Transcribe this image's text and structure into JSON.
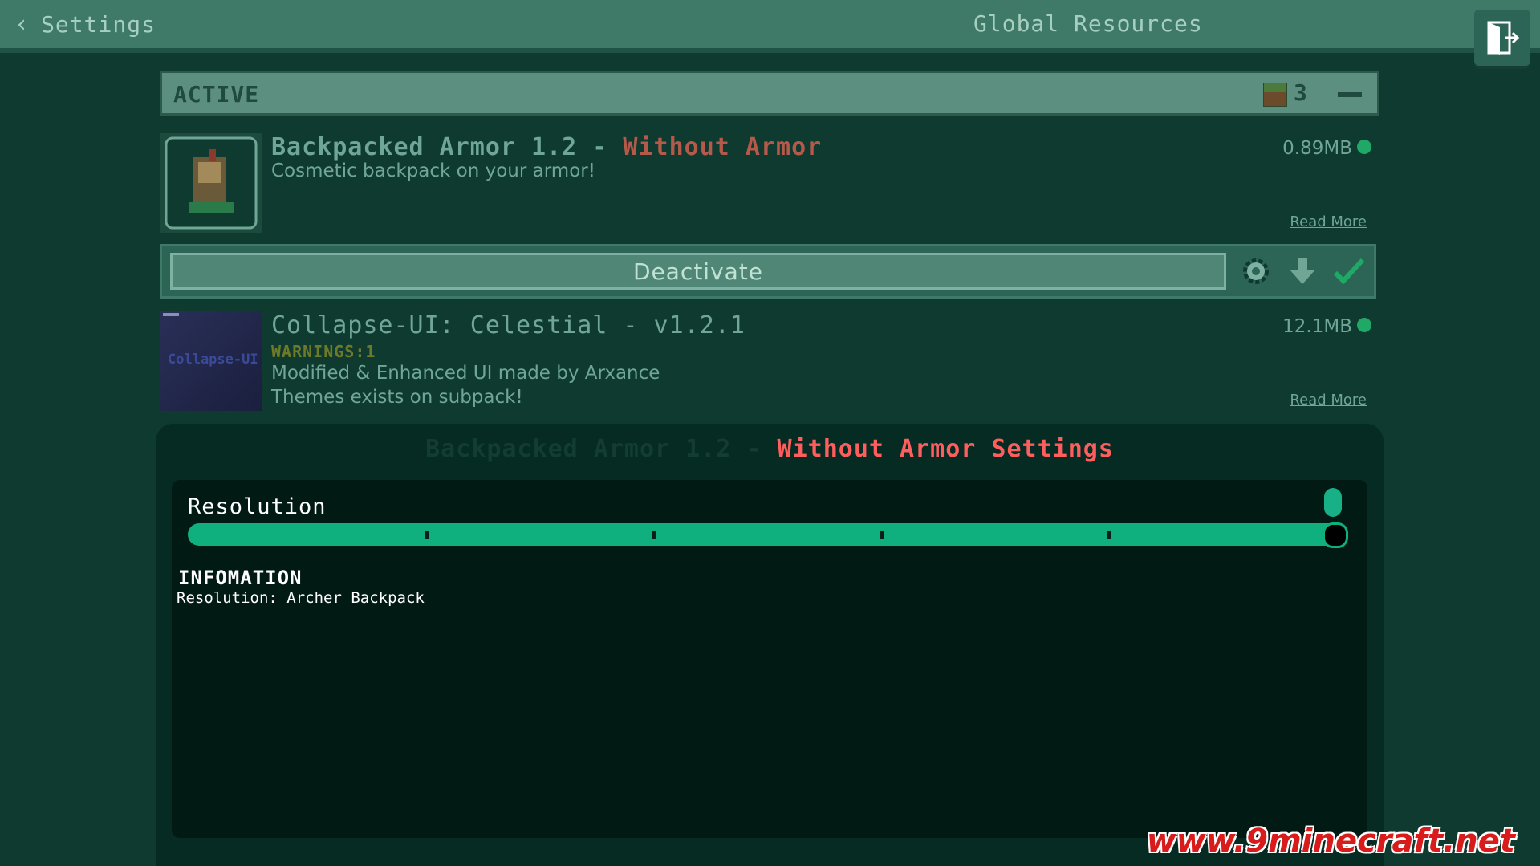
{
  "topbar": {
    "back_label": "Settings",
    "title": "Global Resources"
  },
  "active_section": {
    "title": "ACTIVE",
    "count": "3"
  },
  "packs": [
    {
      "title_main": "Backpacked Armor 1.2 - ",
      "title_accent": "Without Armor",
      "description": "Cosmetic backpack on your armor!",
      "size": "0.89MB",
      "read_more": "Read More"
    },
    {
      "title_main": "Collapse-UI: Celestial - v1.2.1",
      "warnings": "WARNINGS:1",
      "description_lines": [
        "Modified & Enhanced UI made by Arxance",
        "Themes exists on subpack!"
      ],
      "size": "12.1MB",
      "read_more": "Read More",
      "thumb_text": "Collapse-UI"
    }
  ],
  "actionbar": {
    "deactivate_label": "Deactivate"
  },
  "settings_panel": {
    "title_dim": "Backpacked Armor 1.2 - ",
    "title_accent": "Without Armor Settings",
    "slider_label": "Resolution",
    "slider_value_fraction": 1.0,
    "slider_steps": 6,
    "info_heading": "INFOMATION",
    "info_text": "Resolution: Archer Backpack"
  },
  "watermark": "www.9minecraft.net",
  "colors": {
    "accent_green": "#0fb07d",
    "accent_red": "#ff5e5e",
    "status_dot": "#1fa866"
  }
}
